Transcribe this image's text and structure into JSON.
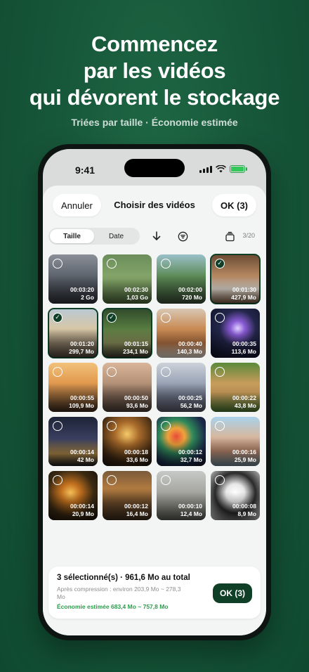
{
  "promo": {
    "headline_lines": [
      "Commencez",
      "par les vidéos",
      "qui dévorent le stockage"
    ],
    "subtitle": "Triées par taille · Économie estimée"
  },
  "status_bar": {
    "time": "9:41"
  },
  "header": {
    "cancel_label": "Annuler",
    "title": "Choisir des vidéos",
    "ok_label": "OK (3)"
  },
  "toolbar": {
    "sort_options": [
      "Taille",
      "Date"
    ],
    "selected_sort": "Taille",
    "icons": [
      "arrow-down-icon",
      "filter-icon",
      "stack-icon"
    ],
    "page_count": "3/20"
  },
  "videos": [
    {
      "duration": "00:03:20",
      "size": "2 Go",
      "selected": false,
      "bg": "linear-gradient(180deg,#8a8f97 0%,#5d636d 45%,#2f343b 100%)"
    },
    {
      "duration": "00:02:30",
      "size": "1,03 Go",
      "selected": false,
      "bg": "linear-gradient(180deg,#6a8d5a 0%,#87a86b 50%,#4d6b3c 100%)"
    },
    {
      "duration": "00:02:00",
      "size": "720 Mo",
      "selected": false,
      "bg": "linear-gradient(180deg,#9ac0c9 0%,#5c8a55 45%,#3c5138 100%)"
    },
    {
      "duration": "00:01:30",
      "size": "427,9 Mo",
      "selected": true,
      "bg": "linear-gradient(180deg,#6a4a32 0%,#b88a63 45%,#e9e2d8 70%,#7b5a40 100%)"
    },
    {
      "duration": "00:01:20",
      "size": "299,7 Mo",
      "selected": true,
      "bg": "linear-gradient(180deg,#b9c8d3 0%,#d7c7a8 40%,#8a7c66 70%,#50463a 100%)"
    },
    {
      "duration": "00:01:15",
      "size": "234,1 Mo",
      "selected": true,
      "bg": "linear-gradient(180deg,#2f4a2b 0%,#567a3f 40%,#8a8f5a 70%,#3c3a30 100%)"
    },
    {
      "duration": "00:00:40",
      "size": "140,3 Mo",
      "selected": false,
      "bg": "linear-gradient(180deg,#d8c7b4 0%,#c98c56 40%,#b07040 70%,#e9e1d6 100%)"
    },
    {
      "duration": "00:00:35",
      "size": "113,6 Mo",
      "selected": false,
      "bg": "radial-gradient(circle at 55% 40%,#e0d3ff 0%,#8a5bd6 18%,#23264a 45%,#0d1022 100%)"
    },
    {
      "duration": "00:00:55",
      "size": "109,9 Mo",
      "selected": false,
      "bg": "linear-gradient(180deg,#f1c27b 0%,#e29a4f 40%,#9a6a3b 70%,#3c2a1c 100%)"
    },
    {
      "duration": "00:00:50",
      "size": "93,6 Mo",
      "selected": false,
      "bg": "linear-gradient(180deg,#d9b69a 0%,#b59378 40%,#7d6454 70%,#4d4038 100%)"
    },
    {
      "duration": "00:00:25",
      "size": "56,2 Mo",
      "selected": false,
      "bg": "linear-gradient(180deg,#cdd2da 0%,#9ba5b6 40%,#6d7488 70%,#5a5b68 100%)"
    },
    {
      "duration": "00:00:22",
      "size": "43,8 Mo",
      "selected": false,
      "bg": "linear-gradient(180deg,#5a8a3a 0%,#c49a5a 40%,#d9a862 60%,#4a7a32 100%)"
    },
    {
      "duration": "00:00:14",
      "size": "42 Mo",
      "selected": false,
      "bg": "linear-gradient(180deg,#1d2436 0%,#3a3f60 45%,#b08a4a 75%,#1a1b22 100%)"
    },
    {
      "duration": "00:00:18",
      "size": "33,6 Mo",
      "selected": false,
      "bg": "radial-gradient(circle at 50% 35%,#f5c96a 0%,#a86a2a 30%,#3d2712 70%,#1a120b 100%)"
    },
    {
      "duration": "00:00:12",
      "size": "32,7 Mo",
      "selected": false,
      "bg": "radial-gradient(circle at 40% 40%,#e84a3a 0%,#f0a23a 20%,#2f8a5a 40%,#1b2a4a 70%,#120f1e 100%)"
    },
    {
      "duration": "00:00:16",
      "size": "25,9 Mo",
      "selected": false,
      "bg": "linear-gradient(180deg,#a9d2ea 0%,#d6b8a0 40%,#b7856a 70%,#6c8a9a 100%)"
    },
    {
      "duration": "00:00:14",
      "size": "20,9 Mo",
      "selected": false,
      "bg": "radial-gradient(circle at 45% 45%,#f6c15a 0%,#c2701e 25%,#3b2a12 60%,#140e08 100%)"
    },
    {
      "duration": "00:00:12",
      "size": "16,4 Mo",
      "selected": false,
      "bg": "linear-gradient(180deg,#7a5a3a 0%,#b07a40 35%,#6a4a2a 65%,#3a2a1c 100%)"
    },
    {
      "duration": "00:00:10",
      "size": "12,4 Mo",
      "selected": false,
      "bg": "linear-gradient(180deg,#c7c9c6 0%,#a8a9a3 40%,#8c8c84 70%,#5a5a52 100%)"
    },
    {
      "duration": "00:00:08",
      "size": "8,9 Mo",
      "selected": false,
      "bg": "radial-gradient(circle at 50% 45%,#ffffff 0%,#e8e8e8 25%,#2a2a2a 55%,#d9d9d9 100%)"
    }
  ],
  "footer": {
    "summary": "3 sélectionné(s) · 961,6 Mo au total",
    "compression": "Après compression : environ 203,9 Mo ~ 278,3 Mo",
    "savings": "Économie estimée 683,4 Mo ~ 757,8 Mo",
    "ok_label": "OK (3)"
  },
  "colors": {
    "accent": "#0f3f27",
    "savings_green": "#2a9d4b",
    "bg_green": "#17573a"
  }
}
